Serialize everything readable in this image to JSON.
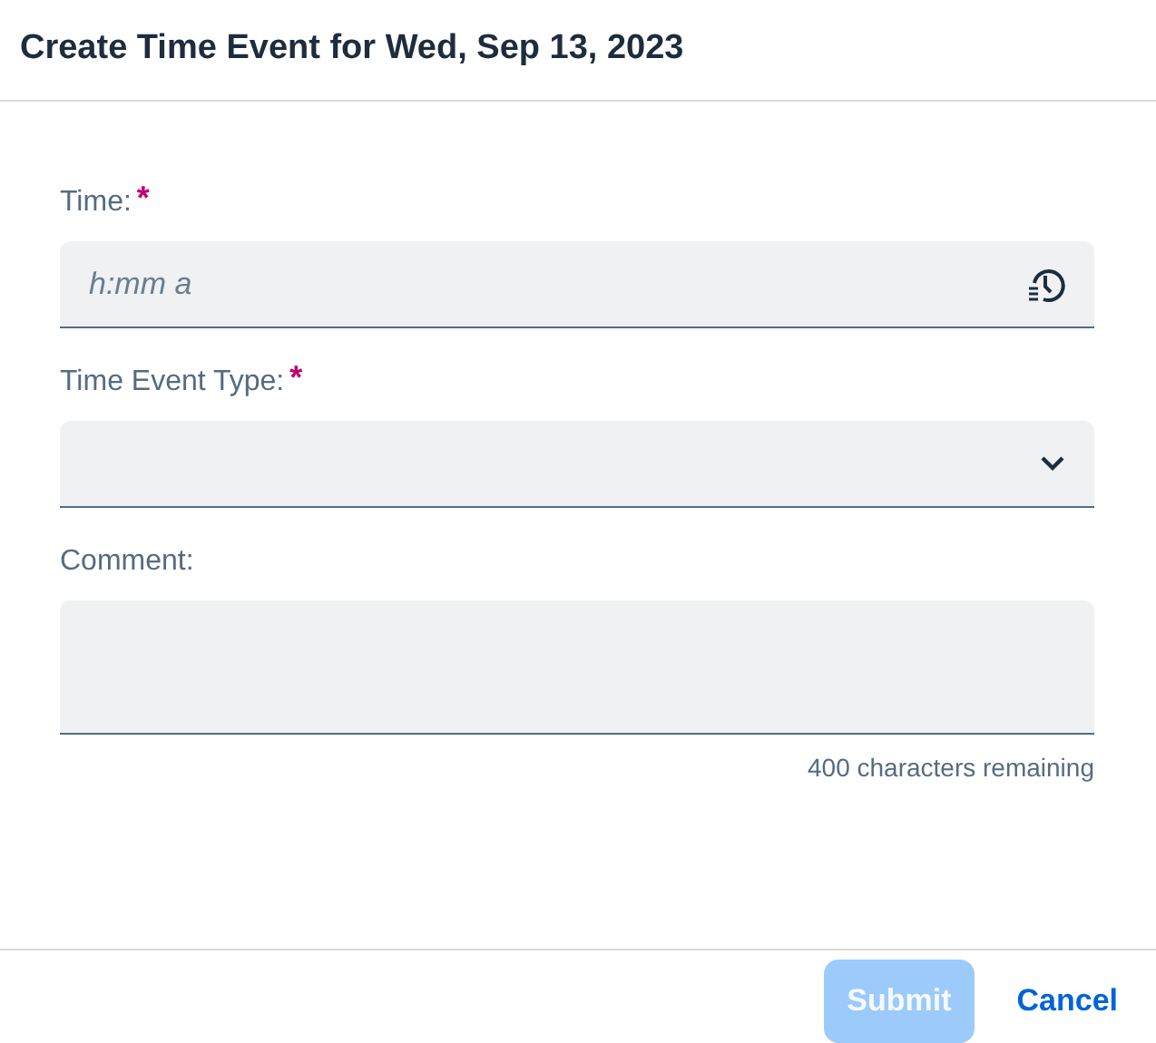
{
  "dialog": {
    "title": "Create Time Event for Wed, Sep 13, 2023"
  },
  "fields": [
    {
      "kind": "time",
      "label": "Time:",
      "required_mark": "*",
      "placeholder": "h:mm a"
    },
    {
      "kind": "select",
      "label": "Time Event Type:",
      "required_mark": "*"
    },
    {
      "kind": "textarea",
      "label": "Comment:",
      "counter": "400 characters remaining"
    }
  ],
  "buttons": [
    {
      "kind": "primary",
      "label": "Submit",
      "disabled": true
    },
    {
      "kind": "link",
      "label": "Cancel",
      "disabled": false
    }
  ]
}
